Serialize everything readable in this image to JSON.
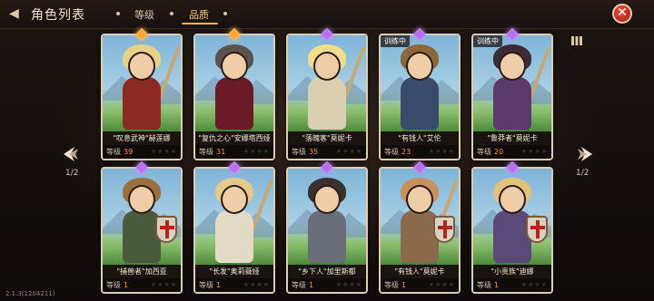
{
  "header": {
    "back_icon": "back-arrow-icon",
    "title": "角色列表",
    "tabs": [
      {
        "label": "等级",
        "active": false
      },
      {
        "label": "品质",
        "active": true
      }
    ],
    "close_icon": "close-icon"
  },
  "pager": {
    "left_label": "1/2",
    "right_label": "1/2"
  },
  "grid_toggle_icon": "grid-view-icon",
  "cards": [
    {
      "name": "\"叹息武神\"赫莲娜",
      "level_label": "等级",
      "level": "39",
      "gem": "orange",
      "training": "",
      "hair": "#e8d28a",
      "outfit": "#8a2a22"
    },
    {
      "name": "\"复仇之心\"安娜塔西娅",
      "level_label": "等级",
      "level": "31",
      "gem": "orange",
      "training": "",
      "hair": "#5a5350",
      "outfit": "#6a1a24"
    },
    {
      "name": "\"落魄客\"莫妮卡",
      "level_label": "等级",
      "level": "35",
      "gem": "purple",
      "training": "",
      "hair": "#f2dc8e",
      "outfit": "#d8d0b0"
    },
    {
      "name": "\"有钱人\"艾伦",
      "level_label": "等级",
      "level": "23",
      "gem": "purple",
      "training": "训练中",
      "hair": "#8a6638",
      "outfit": "#3a4a6a"
    },
    {
      "name": "\"鲁莽者\"莫妮卡",
      "level_label": "等级",
      "level": "20",
      "gem": "purple",
      "training": "训练中",
      "hair": "#3a2a3a",
      "outfit": "#5a3a6a"
    },
    {
      "name": "\"捕兽者\"加西亚",
      "level_label": "等级",
      "level": "1",
      "gem": "purple",
      "training": "",
      "hair": "#9a7040",
      "outfit": "#4a5a3a"
    },
    {
      "name": "\"长发\"奥莉薇娅",
      "level_label": "等级",
      "level": "1",
      "gem": "purple",
      "training": "",
      "hair": "#e6c88a",
      "outfit": "#e2dbc6"
    },
    {
      "name": "\"乡下人\"加里斯都",
      "level_label": "等级",
      "level": "1",
      "gem": "purple",
      "training": "",
      "hair": "#3a3030",
      "outfit": "#6a6e78"
    },
    {
      "name": "\"有钱人\"莫妮卡",
      "level_label": "等级",
      "level": "1",
      "gem": "purple",
      "training": "",
      "hair": "#c79060",
      "outfit": "#8a6a4a"
    },
    {
      "name": "\"小贵族\"迪娜",
      "level_label": "等级",
      "level": "1",
      "gem": "purple",
      "training": "",
      "hair": "#e2c27a",
      "outfit": "#5a4a7a"
    }
  ],
  "stars_glyph": "★★★★",
  "version": "2.1.3(1204211)"
}
